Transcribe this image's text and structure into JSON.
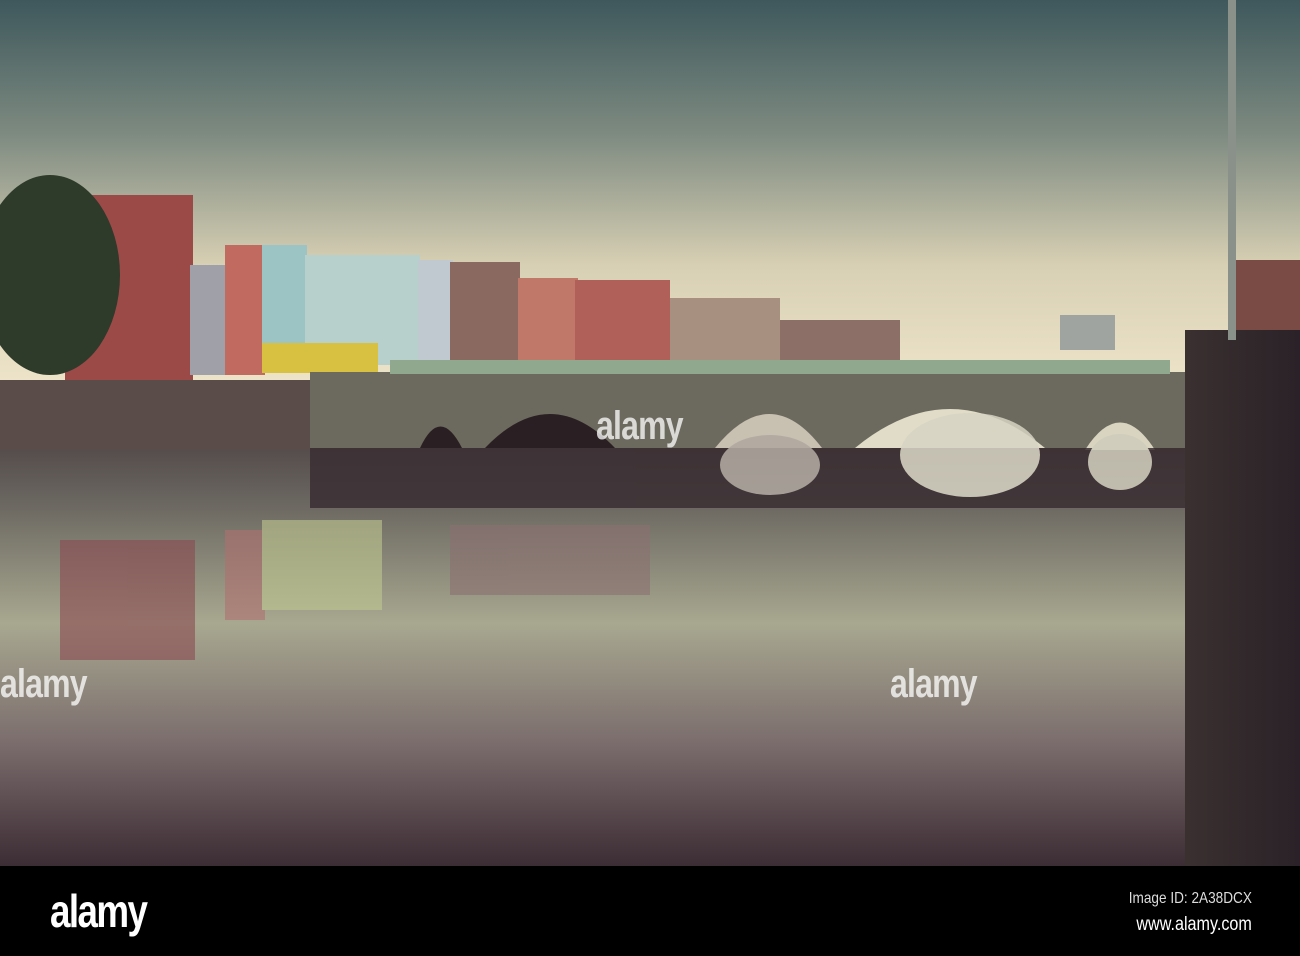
{
  "photo": {
    "subject": "bridge-over-river",
    "watermark": "alamy"
  },
  "footer": {
    "logo": "alamy",
    "image_id": "Image ID: 2A38DCX",
    "url": "www.alamy.com"
  },
  "colors": {
    "sky_top": "#3e585c",
    "sky_horizon": "#e8dfc4",
    "water": "#4a3a40",
    "bridge": "#6c6a5e",
    "railing": "#8fa88e"
  }
}
